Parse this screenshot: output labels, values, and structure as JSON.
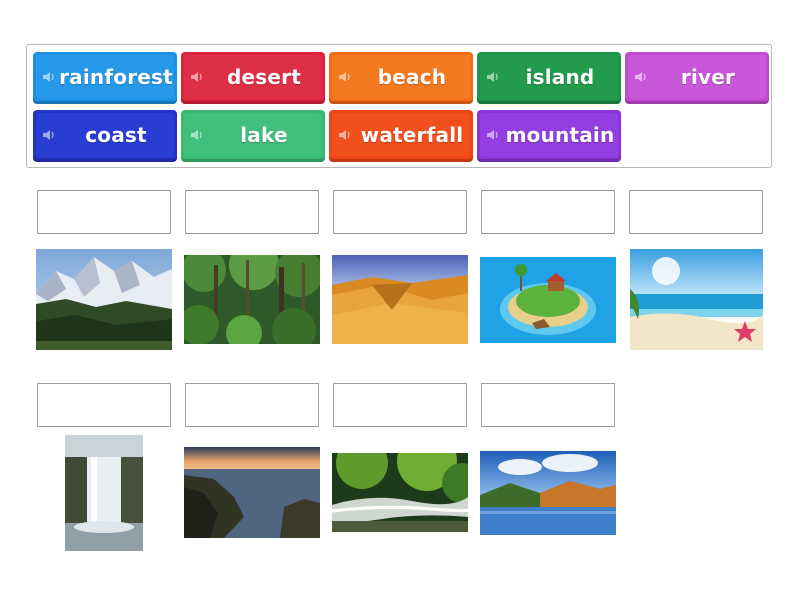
{
  "word_bank": {
    "tiles": [
      {
        "label": "rainforest",
        "color": "#1e8fe3"
      },
      {
        "label": "desert",
        "color": "#d9243b"
      },
      {
        "label": "beach",
        "color": "#f26d13"
      },
      {
        "label": "island",
        "color": "#1f9447"
      },
      {
        "label": "river",
        "color": "#c04ad1"
      },
      {
        "label": "coast",
        "color": "#2233c8"
      },
      {
        "label": "lake",
        "color": "#39b874"
      },
      {
        "label": "waterfall",
        "color": "#ee4512"
      },
      {
        "label": "mountain",
        "color": "#8a35da"
      }
    ],
    "icon": "speaker-icon"
  },
  "answer_slots": [
    {
      "value": ""
    },
    {
      "value": ""
    },
    {
      "value": ""
    },
    {
      "value": ""
    },
    {
      "value": ""
    },
    {
      "value": ""
    },
    {
      "value": ""
    },
    {
      "value": ""
    },
    {
      "value": ""
    }
  ],
  "images": [
    "snowy-mountain-image",
    "rainforest-image",
    "desert-dunes-image",
    "island-image",
    "beach-image",
    "waterfall-image",
    "coast-image",
    "river-image",
    "lake-image"
  ]
}
